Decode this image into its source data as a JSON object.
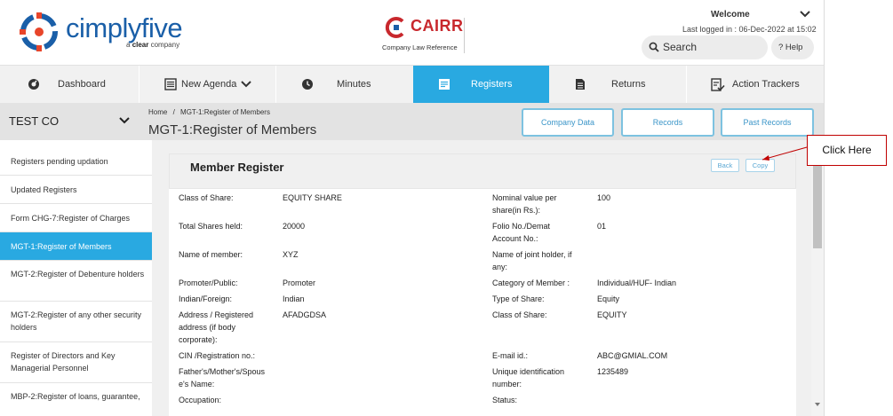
{
  "header": {
    "logo_text": "cimplyfive",
    "logo_sub_prefix": "a",
    "logo_sub_brand": "clear",
    "logo_sub_suffix": "company",
    "cairr_title": "CAIRR",
    "cairr_sub": "Company Law Reference",
    "welcome": "Welcome",
    "last_logged": "Last logged in : 06-Dec-2022 at 15:02",
    "search_label": "Search",
    "help_label": "? Help"
  },
  "nav": {
    "items": [
      {
        "label": "Dashboard",
        "icon": "dashboard-icon"
      },
      {
        "label": "New Agenda",
        "icon": "list-icon"
      },
      {
        "label": "Minutes",
        "icon": "clock-icon"
      },
      {
        "label": "Registers",
        "icon": "register-icon"
      },
      {
        "label": "Returns",
        "icon": "document-icon"
      },
      {
        "label": "Action Trackers",
        "icon": "checklist-icon"
      }
    ],
    "active": "Registers"
  },
  "company": {
    "name": "TEST CO"
  },
  "breadcrumb": {
    "home": "Home",
    "sep": "/",
    "current": "MGT-1:Register of Members"
  },
  "page_title": "MGT-1:Register of Members",
  "header_buttons": {
    "company_data": "Company Data",
    "records": "Records",
    "past_records": "Past Records"
  },
  "sidebar": {
    "items": [
      {
        "label": "Registers pending updation"
      },
      {
        "label": "Updated Registers"
      },
      {
        "label": "Form CHG-7:Register of Charges"
      },
      {
        "label": "MGT-1:Register of Members"
      },
      {
        "label": "MGT-2:Register of Debenture holders"
      },
      {
        "label": "MGT-2:Register of any other security holders"
      },
      {
        "label": "Register of Directors and Key Managerial Personnel"
      },
      {
        "label": "MBP-2:Register of loans, guarantee,"
      }
    ],
    "active_index": 3
  },
  "panel": {
    "title": "Member Register",
    "back_label": "Back",
    "copy_label": "Copy",
    "left_fields": [
      {
        "label": "Class of Share:",
        "value": "EQUITY SHARE"
      },
      {
        "label": "Total Shares held:",
        "value": "20000"
      },
      {
        "label": "Name of member:",
        "value": "XYZ"
      },
      {
        "label": "Promoter/Public:",
        "value": "Promoter"
      },
      {
        "label": "Indian/Foreign:",
        "value": "Indian"
      },
      {
        "label": "Address / Registered address (if body corporate):",
        "value": "AFADGDSA"
      },
      {
        "label": "CIN /Registration no.:",
        "value": ""
      },
      {
        "label": "Father's/Mother's/Spouse's Name:",
        "value": ""
      },
      {
        "label": "Occupation:",
        "value": ""
      }
    ],
    "right_fields": [
      {
        "label": "Nominal value per share(in Rs.):",
        "value": "100"
      },
      {
        "label": "Folio No./Demat Account No.:",
        "value": "01"
      },
      {
        "label": "Name of joint holder, if any:",
        "value": ""
      },
      {
        "label": "Category of Member :",
        "value": "Individual/HUF- Indian"
      },
      {
        "label": "Type of Share:",
        "value": "Equity"
      },
      {
        "label": "Class of Share:",
        "value": "EQUITY"
      },
      {
        "label": "E-mail id.:",
        "value": "ABC@GMIAL.COM"
      },
      {
        "label": "Unique identification number:",
        "value": "1235489"
      },
      {
        "label": "Status:",
        "value": ""
      }
    ]
  },
  "annotation": {
    "text": "Click Here"
  },
  "colors": {
    "brand_blue": "#1a5fa8",
    "accent": "#29a9e1",
    "cairr_red": "#c8282d",
    "callout_border": "#c00000"
  }
}
